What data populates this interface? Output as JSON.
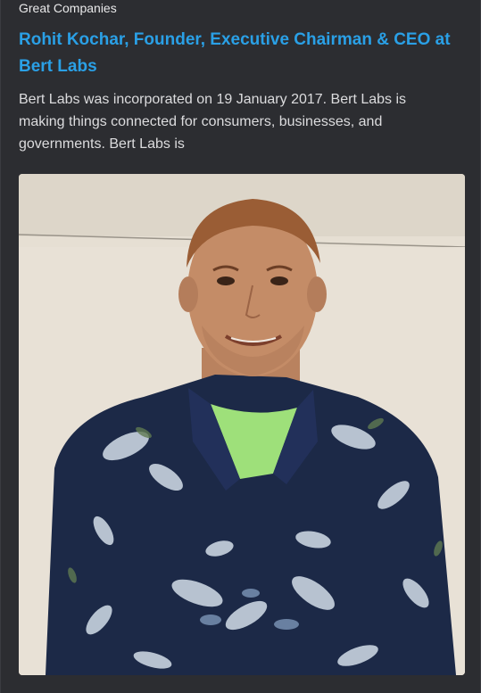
{
  "post": {
    "category": "Great Companies",
    "title": "Rohit Kochar, Founder, Executive Chairman & CEO at Bert Labs",
    "excerpt": "Bert Labs was incorporated on 19 January 2017. Bert Labs is making things connected for consumers, businesses, and governments. Bert Labs is",
    "image_subject": "portrait-photo"
  },
  "colors": {
    "background": "#2c2d31",
    "title": "#2aa0e6",
    "text": "#dcdcde"
  }
}
